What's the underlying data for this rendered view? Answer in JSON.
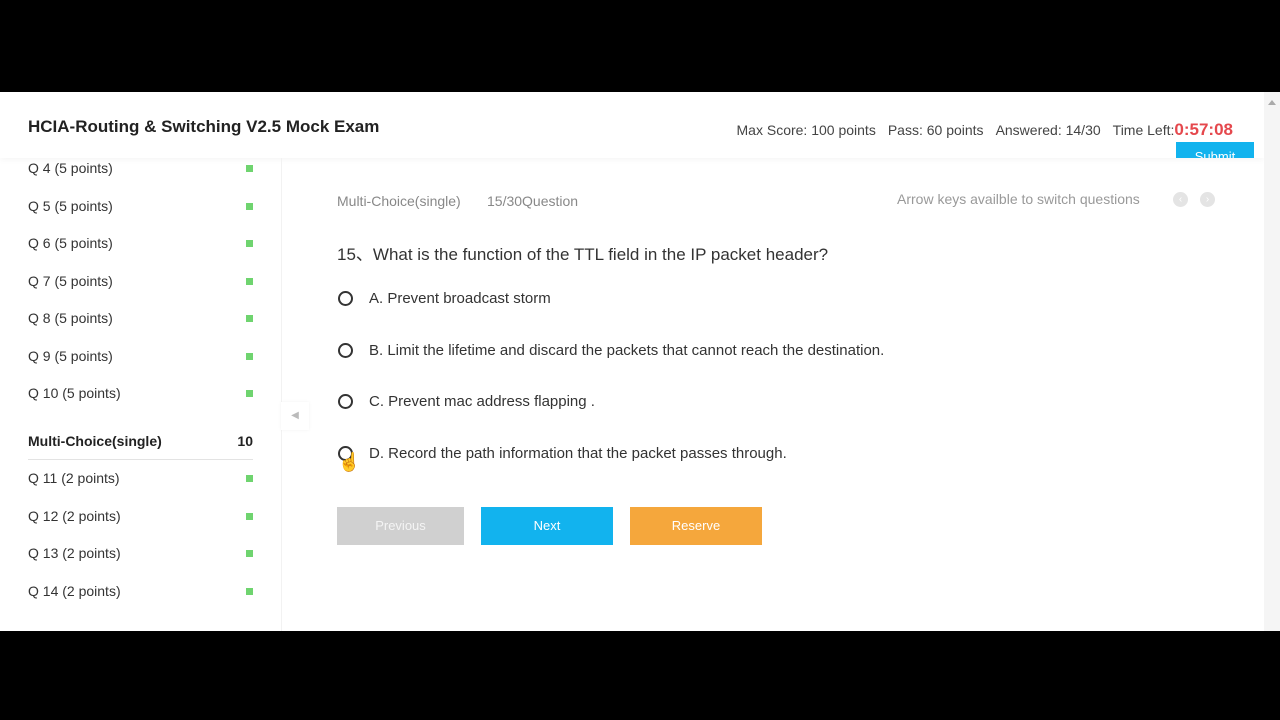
{
  "header": {
    "title": "HCIA-Routing & Switching V2.5 Mock Exam",
    "max_score_label": "Max Score:",
    "max_score": "100 points",
    "pass_label": "Pass:",
    "pass": "60 points",
    "answered_label": "Answered:",
    "answered": "14/30",
    "time_left_label": "Time Left:",
    "time_left": "0:57:08",
    "submit": "Submit"
  },
  "sidebar": {
    "items_a": [
      {
        "label": "Q  4  (5 points)"
      },
      {
        "label": "Q  5  (5 points)"
      },
      {
        "label": "Q  6  (5 points)"
      },
      {
        "label": "Q  7  (5 points)"
      },
      {
        "label": "Q  8  (5 points)"
      },
      {
        "label": "Q  9  (5 points)"
      },
      {
        "label": "Q  10  (5 points)"
      }
    ],
    "section": {
      "label": "Multi-Choice(single)",
      "count": "10"
    },
    "items_b": [
      {
        "label": "Q  11  (2 points)"
      },
      {
        "label": "Q  12  (2 points)"
      },
      {
        "label": "Q  13  (2 points)"
      },
      {
        "label": "Q  14  (2 points)"
      }
    ],
    "answered_color": "#6fd46f"
  },
  "main": {
    "type": "Multi-Choice(single)",
    "progress": "15/30Question",
    "hint": "Arrow keys availble to switch questions",
    "question": "15、What is the function of the TTL field in the IP packet header?",
    "options": [
      {
        "label": "A. Prevent broadcast storm"
      },
      {
        "label": "B. Limit the lifetime and discard the packets that cannot reach the destination."
      },
      {
        "label": "C. Prevent mac address flapping ."
      },
      {
        "label": "D. Record the path information that the packet passes through."
      }
    ],
    "previous": "Previous",
    "next": "Next",
    "reserve": "Reserve"
  },
  "colors": {
    "accent": "#12b3ee",
    "reserve": "#f5a73c",
    "timer": "#e5484d",
    "disabled": "#d0d0d0"
  }
}
